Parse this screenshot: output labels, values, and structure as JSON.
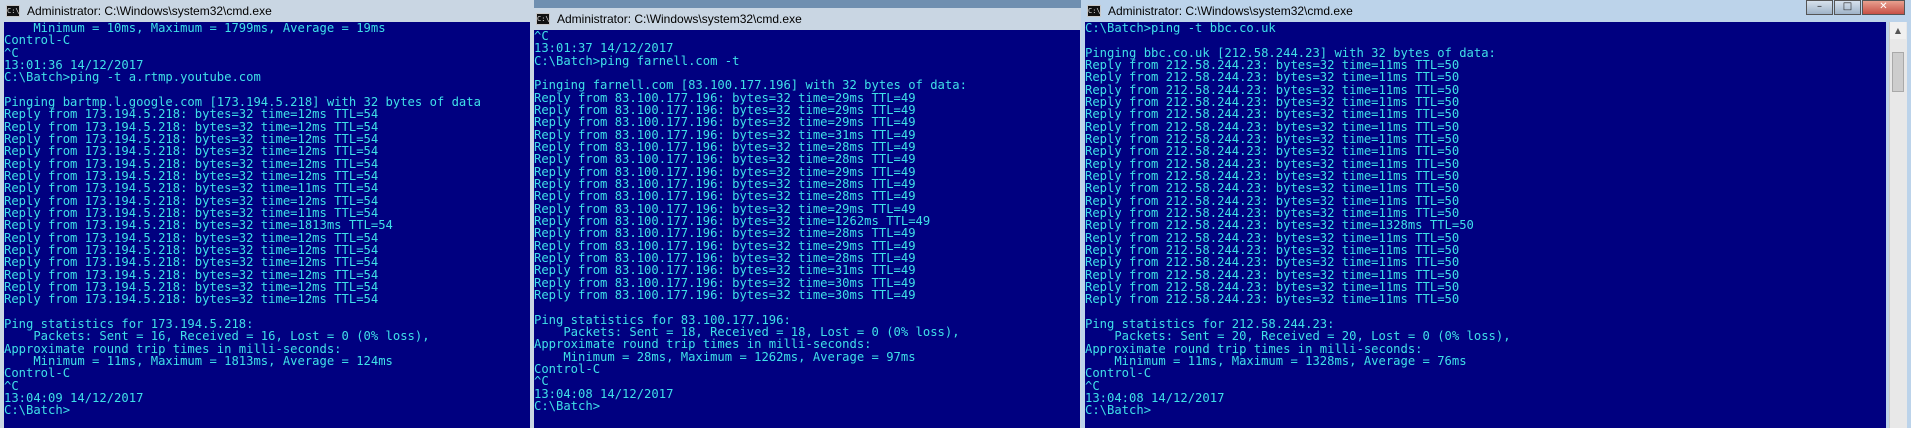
{
  "windows": [
    {
      "title": "Administrator: C:\\Windows\\system32\\cmd.exe",
      "lines": [
        "    Minimum = 10ms, Maximum = 1799ms, Average = 19ms",
        "Control-C",
        "^C",
        "13:01:36 14/12/2017",
        "C:\\Batch>ping -t a.rtmp.youtube.com",
        "",
        "Pinging bartmp.l.google.com [173.194.5.218] with 32 bytes of data",
        "Reply from 173.194.5.218: bytes=32 time=12ms TTL=54",
        "Reply from 173.194.5.218: bytes=32 time=12ms TTL=54",
        "Reply from 173.194.5.218: bytes=32 time=12ms TTL=54",
        "Reply from 173.194.5.218: bytes=32 time=12ms TTL=54",
        "Reply from 173.194.5.218: bytes=32 time=12ms TTL=54",
        "Reply from 173.194.5.218: bytes=32 time=12ms TTL=54",
        "Reply from 173.194.5.218: bytes=32 time=11ms TTL=54",
        "Reply from 173.194.5.218: bytes=32 time=12ms TTL=54",
        "Reply from 173.194.5.218: bytes=32 time=11ms TTL=54",
        "Reply from 173.194.5.218: bytes=32 time=1813ms TTL=54",
        "Reply from 173.194.5.218: bytes=32 time=12ms TTL=54",
        "Reply from 173.194.5.218: bytes=32 time=12ms TTL=54",
        "Reply from 173.194.5.218: bytes=32 time=12ms TTL=54",
        "Reply from 173.194.5.218: bytes=32 time=12ms TTL=54",
        "Reply from 173.194.5.218: bytes=32 time=12ms TTL=54",
        "Reply from 173.194.5.218: bytes=32 time=12ms TTL=54",
        "",
        "Ping statistics for 173.194.5.218:",
        "    Packets: Sent = 16, Received = 16, Lost = 0 (0% loss),",
        "Approximate round trip times in milli-seconds:",
        "    Minimum = 11ms, Maximum = 1813ms, Average = 124ms",
        "Control-C",
        "^C",
        "13:04:09 14/12/2017",
        "C:\\Batch>"
      ]
    },
    {
      "title": "Administrator: C:\\Windows\\system32\\cmd.exe",
      "lines": [
        "^C",
        "13:01:37 14/12/2017",
        "C:\\Batch>ping farnell.com -t",
        "",
        "Pinging farnell.com [83.100.177.196] with 32 bytes of data:",
        "Reply from 83.100.177.196: bytes=32 time=29ms TTL=49",
        "Reply from 83.100.177.196: bytes=32 time=29ms TTL=49",
        "Reply from 83.100.177.196: bytes=32 time=29ms TTL=49",
        "Reply from 83.100.177.196: bytes=32 time=31ms TTL=49",
        "Reply from 83.100.177.196: bytes=32 time=28ms TTL=49",
        "Reply from 83.100.177.196: bytes=32 time=28ms TTL=49",
        "Reply from 83.100.177.196: bytes=32 time=29ms TTL=49",
        "Reply from 83.100.177.196: bytes=32 time=28ms TTL=49",
        "Reply from 83.100.177.196: bytes=32 time=28ms TTL=49",
        "Reply from 83.100.177.196: bytes=32 time=29ms TTL=49",
        "Reply from 83.100.177.196: bytes=32 time=1262ms TTL=49",
        "Reply from 83.100.177.196: bytes=32 time=28ms TTL=49",
        "Reply from 83.100.177.196: bytes=32 time=29ms TTL=49",
        "Reply from 83.100.177.196: bytes=32 time=28ms TTL=49",
        "Reply from 83.100.177.196: bytes=32 time=31ms TTL=49",
        "Reply from 83.100.177.196: bytes=32 time=30ms TTL=49",
        "Reply from 83.100.177.196: bytes=32 time=30ms TTL=49",
        "",
        "Ping statistics for 83.100.177.196:",
        "    Packets: Sent = 18, Received = 18, Lost = 0 (0% loss),",
        "Approximate round trip times in milli-seconds:",
        "    Minimum = 28ms, Maximum = 1262ms, Average = 97ms",
        "Control-C",
        "^C",
        "13:04:08 14/12/2017",
        "C:\\Batch>"
      ]
    },
    {
      "title": "Administrator: C:\\Windows\\system32\\cmd.exe",
      "lines": [
        "C:\\Batch>ping -t bbc.co.uk",
        "",
        "Pinging bbc.co.uk [212.58.244.23] with 32 bytes of data:",
        "Reply from 212.58.244.23: bytes=32 time=11ms TTL=50",
        "Reply from 212.58.244.23: bytes=32 time=11ms TTL=50",
        "Reply from 212.58.244.23: bytes=32 time=11ms TTL=50",
        "Reply from 212.58.244.23: bytes=32 time=11ms TTL=50",
        "Reply from 212.58.244.23: bytes=32 time=11ms TTL=50",
        "Reply from 212.58.244.23: bytes=32 time=11ms TTL=50",
        "Reply from 212.58.244.23: bytes=32 time=11ms TTL=50",
        "Reply from 212.58.244.23: bytes=32 time=11ms TTL=50",
        "Reply from 212.58.244.23: bytes=32 time=11ms TTL=50",
        "Reply from 212.58.244.23: bytes=32 time=11ms TTL=50",
        "Reply from 212.58.244.23: bytes=32 time=11ms TTL=50",
        "Reply from 212.58.244.23: bytes=32 time=11ms TTL=50",
        "Reply from 212.58.244.23: bytes=32 time=11ms TTL=50",
        "Reply from 212.58.244.23: bytes=32 time=1328ms TTL=50",
        "Reply from 212.58.244.23: bytes=32 time=11ms TTL=50",
        "Reply from 212.58.244.23: bytes=32 time=11ms TTL=50",
        "Reply from 212.58.244.23: bytes=32 time=11ms TTL=50",
        "Reply from 212.58.244.23: bytes=32 time=11ms TTL=50",
        "Reply from 212.58.244.23: bytes=32 time=11ms TTL=50",
        "Reply from 212.58.244.23: bytes=32 time=11ms TTL=50",
        "",
        "Ping statistics for 212.58.244.23:",
        "    Packets: Sent = 20, Received = 20, Lost = 0 (0% loss),",
        "Approximate round trip times in milli-seconds:",
        "    Minimum = 11ms, Maximum = 1328ms, Average = 76ms",
        "Control-C",
        "^C",
        "13:04:08 14/12/2017",
        "C:\\Batch>"
      ]
    }
  ],
  "colors": {
    "console_bg": "#000080",
    "console_fg": "#3fe0e8",
    "frame_active": "#bcd3ea",
    "frame_inactive": "#c9d6e3"
  },
  "icons": [
    "cmd-icon",
    "minimize-icon",
    "maximize-icon",
    "close-icon",
    "scroll-up-icon"
  ]
}
